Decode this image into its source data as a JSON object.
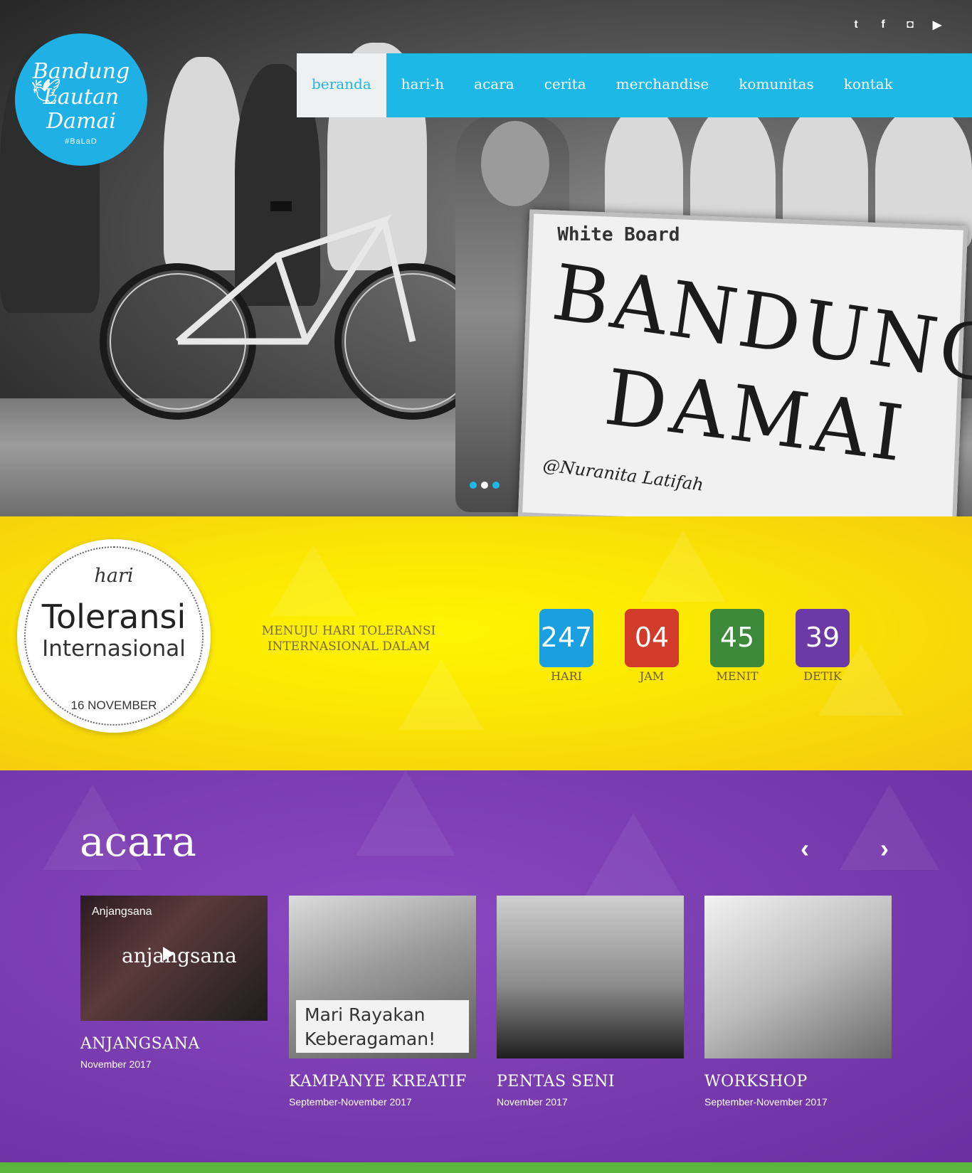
{
  "brand": {
    "logo_line1": "Bandung",
    "logo_line2": "Lautan",
    "logo_line3": "Damai",
    "logo_tag": "#BaLaD"
  },
  "social": [
    {
      "name": "twitter-icon",
      "glyph": "t"
    },
    {
      "name": "facebook-icon",
      "glyph": "f"
    },
    {
      "name": "instagram-icon",
      "glyph": "◘"
    },
    {
      "name": "youtube-icon",
      "glyph": "▶"
    }
  ],
  "nav": {
    "items": [
      "beranda",
      "hari-h",
      "acara",
      "cerita",
      "merchandise",
      "komunitas",
      "kontak"
    ],
    "active": 0
  },
  "hero": {
    "board_brand": "White Board",
    "board_line1": "BANDUNG",
    "board_line2": "DAMAI",
    "board_signature": "@Nuranita Latifah",
    "slides": 3,
    "active_slide": 1
  },
  "tolerance": {
    "badge_hari": "hari",
    "badge_title": "Toleransi",
    "badge_sub": "Internasional",
    "badge_date": "16 NOVEMBER",
    "menuju": "MENUJU HARI TOLERANSI INTERNASIONAL DALAM",
    "countdown": [
      {
        "value": "247",
        "label": "HARI",
        "color": "#1a9fe0"
      },
      {
        "value": "04",
        "label": "JAM",
        "color": "#d23b2a"
      },
      {
        "value": "45",
        "label": "MENIT",
        "color": "#3d8b3a"
      },
      {
        "value": "39",
        "label": "DETIK",
        "color": "#6b3aa6"
      }
    ]
  },
  "events": {
    "title": "acara",
    "prev_icon": "‹",
    "next_icon": "›",
    "cards": [
      {
        "title": "ANJANGSANA",
        "date": "November 2017",
        "thumb_caption": "Anjangsana",
        "thumb_overlay": "anjangsana"
      },
      {
        "title": "KAMPANYE KREATIF",
        "date": "September-November 2017",
        "thumb_caption": "Mari Rayakan Keberagaman!"
      },
      {
        "title": "PENTAS SENI",
        "date": "November 2017"
      },
      {
        "title": "WORKSHOP",
        "date": "September-November 2017"
      }
    ]
  },
  "colors": {
    "nav_blue": "#1db8e6",
    "yellow": "#fbe703",
    "purple": "#7a3db0",
    "green": "#5cb53d"
  }
}
